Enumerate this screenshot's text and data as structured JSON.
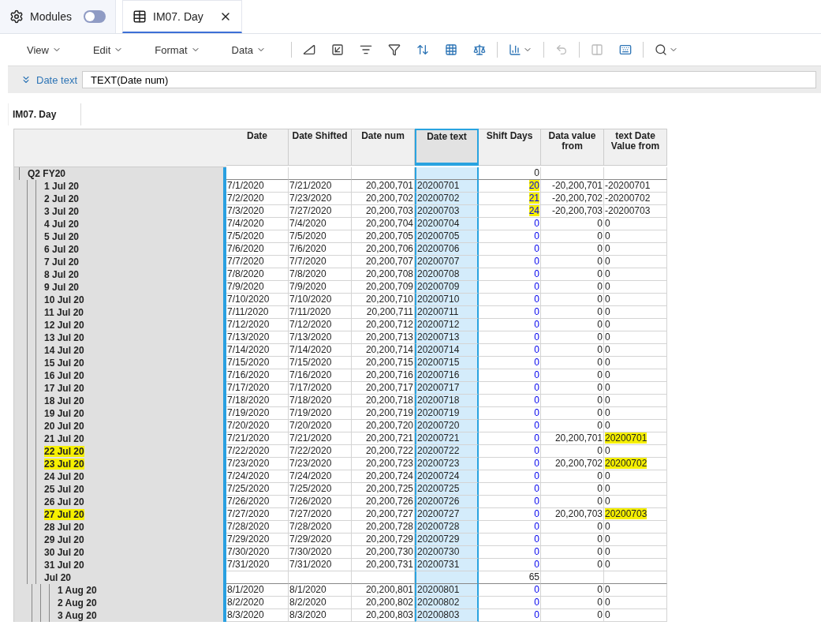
{
  "modules": {
    "label": "Modules",
    "on": false
  },
  "tabs": [
    {
      "label": "IM07. Day",
      "selected": true
    }
  ],
  "menus": [
    "View",
    "Edit",
    "Format",
    "Data"
  ],
  "formula": {
    "label": "Date text",
    "value": "TEXT(Date num)"
  },
  "view_tab": "IM07. Day",
  "columns": [
    {
      "label": "Date",
      "selected": false
    },
    {
      "label": "Date Shifted",
      "selected": false
    },
    {
      "label": "Date num",
      "selected": false
    },
    {
      "label": "Date text",
      "selected": true
    },
    {
      "label": "Shift Days",
      "selected": false
    },
    {
      "label": "Data value from",
      "selected": false
    },
    {
      "label": "text Date Value from",
      "selected": false
    }
  ],
  "top_row": {
    "label": "Q2 FY20",
    "shift": "0"
  },
  "group": {
    "label": "Jul 20",
    "shift": "65",
    "children": [
      {
        "label": "1 Jul 20",
        "cells": [
          "7/1/2020",
          "7/21/2020",
          "20,200,701",
          "20200701",
          "20",
          "-20,200,701",
          "-20200701"
        ],
        "label_marked": false,
        "shift_marked": true,
        "text_from_marked": false
      },
      {
        "label": "2 Jul 20",
        "cells": [
          "7/2/2020",
          "7/23/2020",
          "20,200,702",
          "20200702",
          "21",
          "-20,200,702",
          "-20200702"
        ],
        "label_marked": false,
        "shift_marked": true,
        "text_from_marked": false
      },
      {
        "label": "3 Jul 20",
        "cells": [
          "7/3/2020",
          "7/27/2020",
          "20,200,703",
          "20200703",
          "24",
          "-20,200,703",
          "-20200703"
        ],
        "label_marked": false,
        "shift_marked": true,
        "text_from_marked": false
      },
      {
        "label": "4 Jul 20",
        "cells": [
          "7/4/2020",
          "7/4/2020",
          "20,200,704",
          "20200704",
          "0",
          "0",
          "0"
        ],
        "label_marked": false,
        "shift_marked": false,
        "text_from_marked": false
      },
      {
        "label": "5 Jul 20",
        "cells": [
          "7/5/2020",
          "7/5/2020",
          "20,200,705",
          "20200705",
          "0",
          "0",
          "0"
        ],
        "label_marked": false,
        "shift_marked": false,
        "text_from_marked": false
      },
      {
        "label": "6 Jul 20",
        "cells": [
          "7/6/2020",
          "7/6/2020",
          "20,200,706",
          "20200706",
          "0",
          "0",
          "0"
        ],
        "label_marked": false,
        "shift_marked": false,
        "text_from_marked": false
      },
      {
        "label": "7 Jul 20",
        "cells": [
          "7/7/2020",
          "7/7/2020",
          "20,200,707",
          "20200707",
          "0",
          "0",
          "0"
        ],
        "label_marked": false,
        "shift_marked": false,
        "text_from_marked": false
      },
      {
        "label": "8 Jul 20",
        "cells": [
          "7/8/2020",
          "7/8/2020",
          "20,200,708",
          "20200708",
          "0",
          "0",
          "0"
        ],
        "label_marked": false,
        "shift_marked": false,
        "text_from_marked": false
      },
      {
        "label": "9 Jul 20",
        "cells": [
          "7/9/2020",
          "7/9/2020",
          "20,200,709",
          "20200709",
          "0",
          "0",
          "0"
        ],
        "label_marked": false,
        "shift_marked": false,
        "text_from_marked": false
      },
      {
        "label": "10 Jul 20",
        "cells": [
          "7/10/2020",
          "7/10/2020",
          "20,200,710",
          "20200710",
          "0",
          "0",
          "0"
        ],
        "label_marked": false,
        "shift_marked": false,
        "text_from_marked": false
      },
      {
        "label": "11 Jul 20",
        "cells": [
          "7/11/2020",
          "7/11/2020",
          "20,200,711",
          "20200711",
          "0",
          "0",
          "0"
        ],
        "label_marked": false,
        "shift_marked": false,
        "text_from_marked": false
      },
      {
        "label": "12 Jul 20",
        "cells": [
          "7/12/2020",
          "7/12/2020",
          "20,200,712",
          "20200712",
          "0",
          "0",
          "0"
        ],
        "label_marked": false,
        "shift_marked": false,
        "text_from_marked": false
      },
      {
        "label": "13 Jul 20",
        "cells": [
          "7/13/2020",
          "7/13/2020",
          "20,200,713",
          "20200713",
          "0",
          "0",
          "0"
        ],
        "label_marked": false,
        "shift_marked": false,
        "text_from_marked": false
      },
      {
        "label": "14 Jul 20",
        "cells": [
          "7/14/2020",
          "7/14/2020",
          "20,200,714",
          "20200714",
          "0",
          "0",
          "0"
        ],
        "label_marked": false,
        "shift_marked": false,
        "text_from_marked": false
      },
      {
        "label": "15 Jul 20",
        "cells": [
          "7/15/2020",
          "7/15/2020",
          "20,200,715",
          "20200715",
          "0",
          "0",
          "0"
        ],
        "label_marked": false,
        "shift_marked": false,
        "text_from_marked": false
      },
      {
        "label": "16 Jul 20",
        "cells": [
          "7/16/2020",
          "7/16/2020",
          "20,200,716",
          "20200716",
          "0",
          "0",
          "0"
        ],
        "label_marked": false,
        "shift_marked": false,
        "text_from_marked": false
      },
      {
        "label": "17 Jul 20",
        "cells": [
          "7/17/2020",
          "7/17/2020",
          "20,200,717",
          "20200717",
          "0",
          "0",
          "0"
        ],
        "label_marked": false,
        "shift_marked": false,
        "text_from_marked": false
      },
      {
        "label": "18 Jul 20",
        "cells": [
          "7/18/2020",
          "7/18/2020",
          "20,200,718",
          "20200718",
          "0",
          "0",
          "0"
        ],
        "label_marked": false,
        "shift_marked": false,
        "text_from_marked": false
      },
      {
        "label": "19 Jul 20",
        "cells": [
          "7/19/2020",
          "7/19/2020",
          "20,200,719",
          "20200719",
          "0",
          "0",
          "0"
        ],
        "label_marked": false,
        "shift_marked": false,
        "text_from_marked": false
      },
      {
        "label": "20 Jul 20",
        "cells": [
          "7/20/2020",
          "7/20/2020",
          "20,200,720",
          "20200720",
          "0",
          "0",
          "0"
        ],
        "label_marked": false,
        "shift_marked": false,
        "text_from_marked": false
      },
      {
        "label": "21 Jul 20",
        "cells": [
          "7/21/2020",
          "7/21/2020",
          "20,200,721",
          "20200721",
          "0",
          "20,200,701",
          "20200701"
        ],
        "label_marked": false,
        "shift_marked": false,
        "text_from_marked": true
      },
      {
        "label": "22 Jul 20",
        "cells": [
          "7/22/2020",
          "7/22/2020",
          "20,200,722",
          "20200722",
          "0",
          "0",
          "0"
        ],
        "label_marked": true,
        "shift_marked": false,
        "text_from_marked": false
      },
      {
        "label": "23 Jul 20",
        "cells": [
          "7/23/2020",
          "7/23/2020",
          "20,200,723",
          "20200723",
          "0",
          "20,200,702",
          "20200702"
        ],
        "label_marked": true,
        "shift_marked": false,
        "text_from_marked": true
      },
      {
        "label": "24 Jul 20",
        "cells": [
          "7/24/2020",
          "7/24/2020",
          "20,200,724",
          "20200724",
          "0",
          "0",
          "0"
        ],
        "label_marked": false,
        "shift_marked": false,
        "text_from_marked": false
      },
      {
        "label": "25 Jul 20",
        "cells": [
          "7/25/2020",
          "7/25/2020",
          "20,200,725",
          "20200725",
          "0",
          "0",
          "0"
        ],
        "label_marked": false,
        "shift_marked": false,
        "text_from_marked": false
      },
      {
        "label": "26 Jul 20",
        "cells": [
          "7/26/2020",
          "7/26/2020",
          "20,200,726",
          "20200726",
          "0",
          "0",
          "0"
        ],
        "label_marked": false,
        "shift_marked": false,
        "text_from_marked": false
      },
      {
        "label": "27 Jul 20",
        "cells": [
          "7/27/2020",
          "7/27/2020",
          "20,200,727",
          "20200727",
          "0",
          "20,200,703",
          "20200703"
        ],
        "label_marked": true,
        "shift_marked": false,
        "text_from_marked": true
      },
      {
        "label": "28 Jul 20",
        "cells": [
          "7/28/2020",
          "7/28/2020",
          "20,200,728",
          "20200728",
          "0",
          "0",
          "0"
        ],
        "label_marked": false,
        "shift_marked": false,
        "text_from_marked": false
      },
      {
        "label": "29 Jul 20",
        "cells": [
          "7/29/2020",
          "7/29/2020",
          "20,200,729",
          "20200729",
          "0",
          "0",
          "0"
        ],
        "label_marked": false,
        "shift_marked": false,
        "text_from_marked": false
      },
      {
        "label": "30 Jul 20",
        "cells": [
          "7/30/2020",
          "7/30/2020",
          "20,200,730",
          "20200730",
          "0",
          "0",
          "0"
        ],
        "label_marked": false,
        "shift_marked": false,
        "text_from_marked": false
      },
      {
        "label": "31 Jul 20",
        "cells": [
          "7/31/2020",
          "7/31/2020",
          "20,200,731",
          "20200731",
          "0",
          "0",
          "0"
        ],
        "label_marked": false,
        "shift_marked": false,
        "text_from_marked": false
      }
    ]
  },
  "next_rows": [
    {
      "label": "1 Aug 20",
      "cells": [
        "8/1/2020",
        "8/1/2020",
        "20,200,801",
        "20200801",
        "0",
        "0",
        "0"
      ],
      "label_marked": false,
      "shift_marked": false,
      "text_from_marked": false
    },
    {
      "label": "2 Aug 20",
      "cells": [
        "8/2/2020",
        "8/2/2020",
        "20,200,802",
        "20200802",
        "0",
        "0",
        "0"
      ],
      "label_marked": false,
      "shift_marked": false,
      "text_from_marked": false
    },
    {
      "label": "3 Aug 20",
      "cells": [
        "8/3/2020",
        "8/3/2020",
        "20,200,803",
        "20200803",
        "0",
        "0",
        "0"
      ],
      "label_marked": false,
      "shift_marked": false,
      "text_from_marked": false
    }
  ]
}
